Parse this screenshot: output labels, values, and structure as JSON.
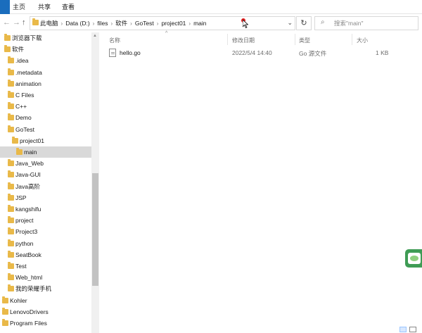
{
  "ribbon": {
    "tabs": [
      "主页",
      "共享",
      "查看"
    ]
  },
  "address": {
    "crumbs": [
      "此电脑",
      "Data (D:)",
      "files",
      "软件",
      "GoTest",
      "project01",
      "main"
    ]
  },
  "search": {
    "placeholder": "搜索\"main\""
  },
  "columns": {
    "name": "名称",
    "date": "修改日期",
    "type": "类型",
    "size": "大小"
  },
  "files": [
    {
      "name": "hello.go",
      "date": "2022/5/4 14:40",
      "type": "Go 源文件",
      "size": "1 KB"
    }
  ],
  "nav": [
    {
      "label": "浏览器下载",
      "indent": 0
    },
    {
      "label": "软件",
      "indent": 0
    },
    {
      "label": ".idea",
      "indent": 1
    },
    {
      "label": ".metadata",
      "indent": 1
    },
    {
      "label": "animation",
      "indent": 1
    },
    {
      "label": "C Files",
      "indent": 1
    },
    {
      "label": "C++",
      "indent": 1
    },
    {
      "label": "Demo",
      "indent": 1
    },
    {
      "label": "GoTest",
      "indent": 1
    },
    {
      "label": "project01",
      "indent": 2
    },
    {
      "label": "main",
      "indent": 3,
      "selected": true
    },
    {
      "label": "Java_Web",
      "indent": 1
    },
    {
      "label": "Java-GUI",
      "indent": 1
    },
    {
      "label": "Java高阶",
      "indent": 1
    },
    {
      "label": "JSP",
      "indent": 1
    },
    {
      "label": "kangshifu",
      "indent": 1
    },
    {
      "label": "project",
      "indent": 1
    },
    {
      "label": "Project3",
      "indent": 1
    },
    {
      "label": "python",
      "indent": 1
    },
    {
      "label": "SeatBook",
      "indent": 1
    },
    {
      "label": "Test",
      "indent": 1
    },
    {
      "label": "Web_html",
      "indent": 1
    },
    {
      "label": "我的荣耀手机",
      "indent": 1
    },
    {
      "label": "Kohler",
      "indent": -1
    },
    {
      "label": "LenovoDrivers",
      "indent": -1
    },
    {
      "label": "Program Files",
      "indent": -1
    }
  ],
  "colors": {
    "folder": "#e9b949",
    "selected": "#d9d9d9",
    "file_tab": "#1a6dbd"
  }
}
